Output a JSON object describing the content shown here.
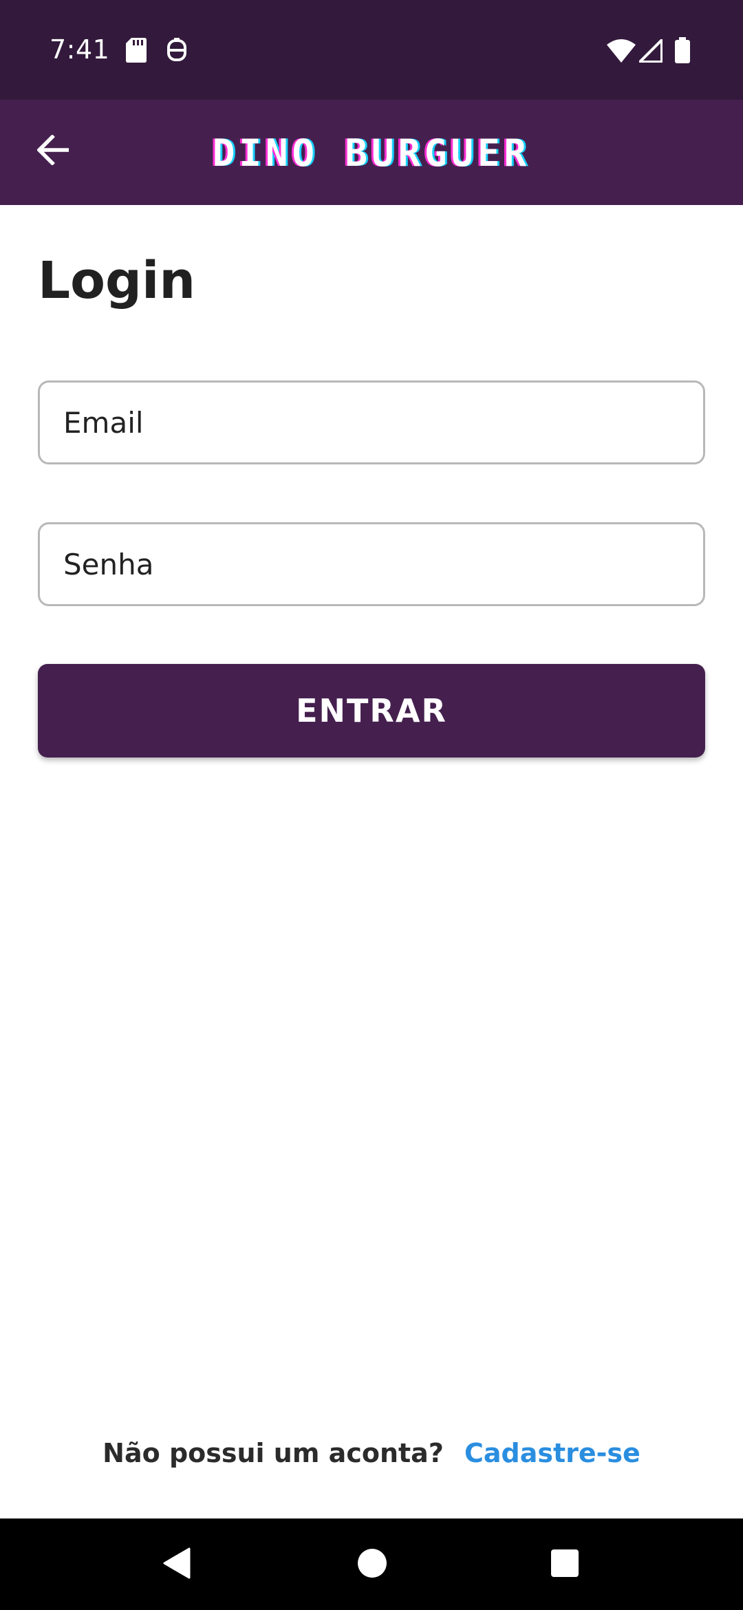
{
  "status_bar": {
    "time": "7:41",
    "icons": [
      "sd-card-icon",
      "notification-icon",
      "wifi-icon",
      "signal-icon",
      "battery-icon"
    ]
  },
  "app_bar": {
    "title": "DINO BURGUER",
    "back_icon": "arrow-left-icon"
  },
  "page": {
    "title": "Login"
  },
  "form": {
    "email_placeholder": "Email",
    "email_value": "",
    "password_placeholder": "Senha",
    "password_value": "",
    "submit_label": "ENTRAR"
  },
  "footer": {
    "question": "Não possui um aconta?",
    "signup_label": "Cadastre-se"
  },
  "nav_bar": {
    "buttons": [
      "back-triangle-icon",
      "home-circle-icon",
      "recents-square-icon"
    ]
  },
  "colors": {
    "status_bar": "#331a3c",
    "app_bar": "#45204f",
    "primary_button": "#45204f",
    "link": "#2a8ee0",
    "title_glow_pink": "#ff2fd6",
    "title_glow_cyan": "#18d2ff"
  }
}
